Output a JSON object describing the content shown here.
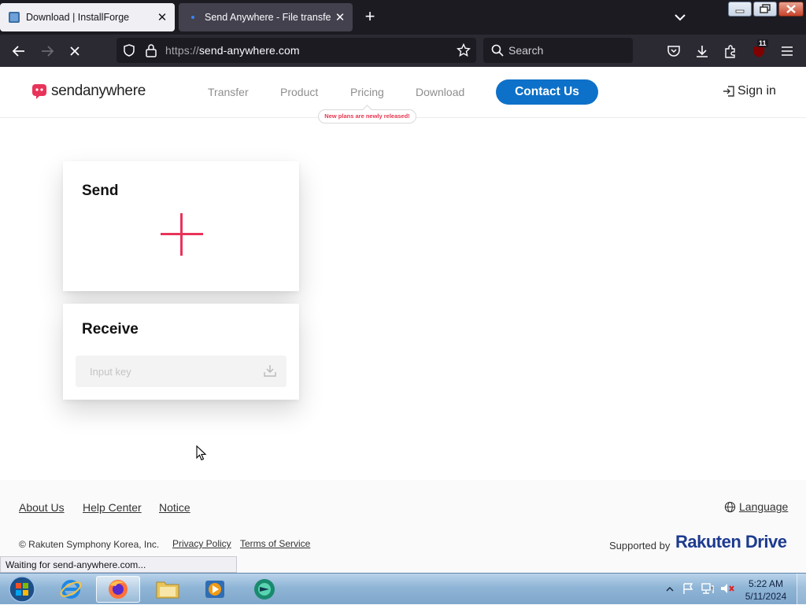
{
  "browser": {
    "tabs": [
      {
        "title": "Download | InstallForge",
        "active": false
      },
      {
        "title": "Send Anywhere - File transfer",
        "active": true
      }
    ],
    "url_protocol": "https://",
    "url_host": "send-anywhere.com",
    "search_placeholder": "Search",
    "extension_badge": "11",
    "status_text": "Waiting for send-anywhere.com..."
  },
  "site": {
    "logo_text": "sendanywhere",
    "nav": [
      "Transfer",
      "Product",
      "Pricing",
      "Download"
    ],
    "pricing_tooltip": "New plans are newly released!",
    "contact_button": "Contact Us",
    "sign_in": "Sign in",
    "send_title": "Send",
    "receive_title": "Receive",
    "input_key_placeholder": "Input key",
    "footer": {
      "links": [
        "About Us",
        "Help Center",
        "Notice"
      ],
      "language": "Language",
      "copyright": "© Rakuten Symphony Korea, Inc.",
      "privacy": "Privacy Policy",
      "terms": "Terms of Service",
      "supported_by": "Supported by",
      "brand": "Rakuten Drive"
    }
  },
  "taskbar": {
    "time": "5:22 AM",
    "date": "5/11/2024"
  },
  "colors": {
    "accent_red": "#e8345a",
    "contact_blue": "#0d71c9",
    "rakuten_blue": "#1d3b8f"
  }
}
